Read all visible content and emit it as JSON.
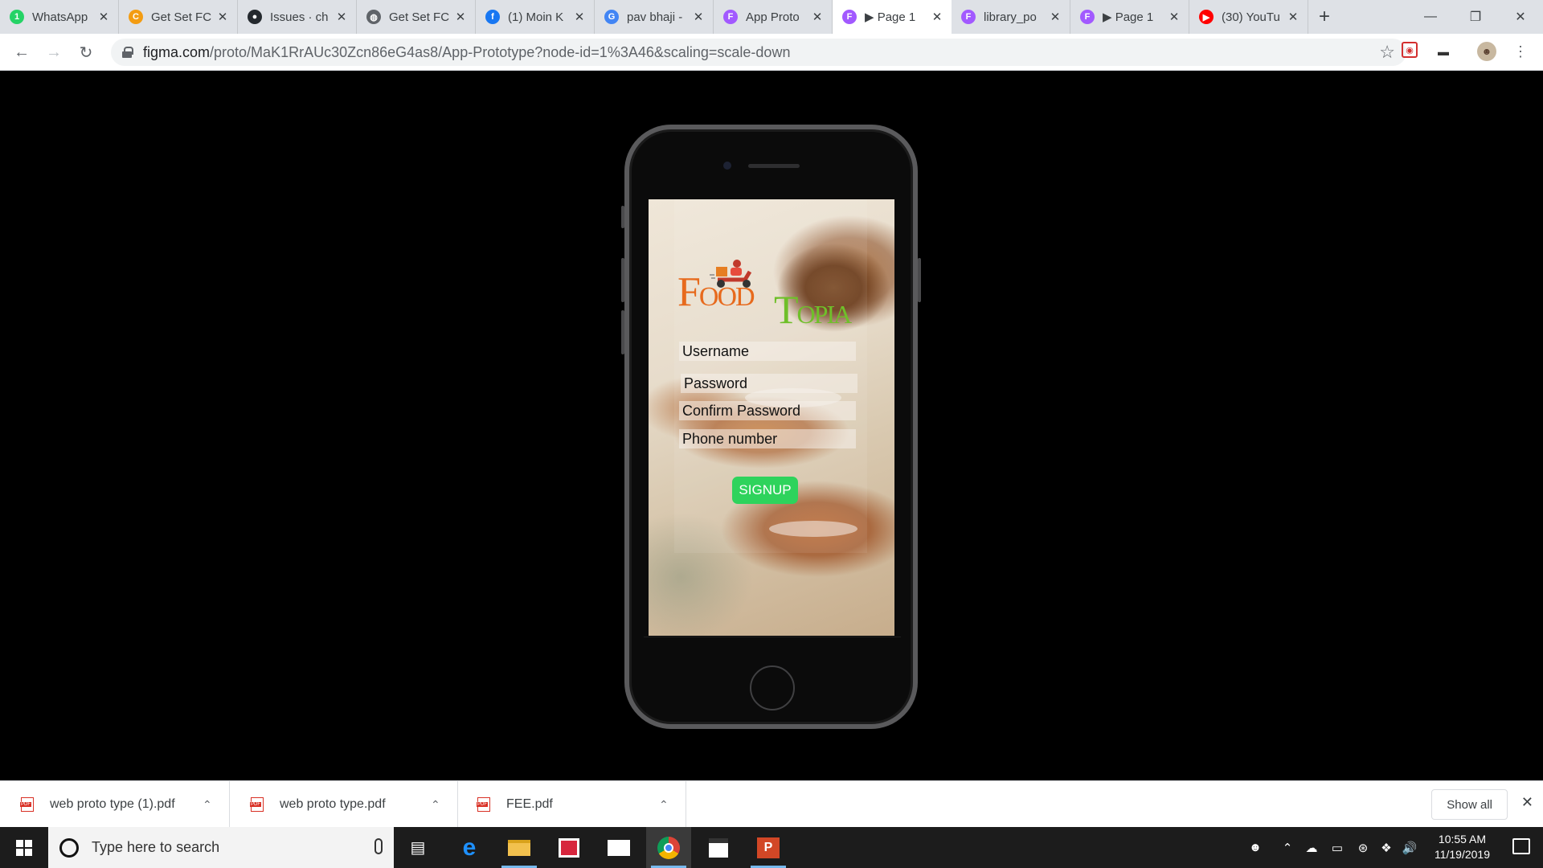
{
  "browser": {
    "tabs": [
      {
        "title": "WhatsApp",
        "icon": "whatsapp-icon",
        "color": "#25d366",
        "glyph": "1"
      },
      {
        "title": "Get Set FC",
        "icon": "orange-c-icon",
        "color": "#f39c12",
        "glyph": "C"
      },
      {
        "title": "Issues · ch",
        "icon": "github-icon",
        "color": "#24292e",
        "glyph": "●"
      },
      {
        "title": "Get Set FC",
        "icon": "globe-icon",
        "color": "#5f6368",
        "glyph": "◍"
      },
      {
        "title": "(1) Moin K",
        "icon": "facebook-icon",
        "color": "#1877f2",
        "glyph": "f"
      },
      {
        "title": "pav bhaji -",
        "icon": "google-icon",
        "color": "#4285f4",
        "glyph": "G"
      },
      {
        "title": "App Proto",
        "icon": "figma-icon",
        "color": "#a259ff",
        "glyph": "F"
      },
      {
        "title": "▶ Page 1",
        "icon": "figma-icon",
        "color": "#a259ff",
        "glyph": "F",
        "active": true
      },
      {
        "title": "library_po",
        "icon": "figma-icon",
        "color": "#a259ff",
        "glyph": "F"
      },
      {
        "title": "▶ Page 1",
        "icon": "figma-icon",
        "color": "#a259ff",
        "glyph": "F"
      },
      {
        "title": "(30) YouTu",
        "icon": "youtube-icon",
        "color": "#ff0000",
        "glyph": "▶"
      }
    ],
    "url_domain": "figma.com",
    "url_path": "/proto/MaK1RrAUc30Zcn86eG4as8/App-Prototype?node-id=1%3A46&scaling=scale-down"
  },
  "app": {
    "logo_food_big": "F",
    "logo_food_small": "OOD",
    "logo_topia_big": "T",
    "logo_topia_small": "OPIA",
    "fields": {
      "username": "Username",
      "password": "Password",
      "confirm_password": "Confirm Password",
      "phone": "Phone number"
    },
    "signup_label": "SIGNUP",
    "colors": {
      "signup": "#2ed35c",
      "food": "#e76a1d",
      "topia": "#6fbf2a"
    }
  },
  "downloads": {
    "items": [
      "web proto type (1).pdf",
      "web proto type.pdf",
      "FEE.pdf"
    ],
    "show_all": "Show all"
  },
  "taskbar": {
    "search_placeholder": "Type here to search",
    "time": "10:55 AM",
    "date": "11/19/2019"
  }
}
